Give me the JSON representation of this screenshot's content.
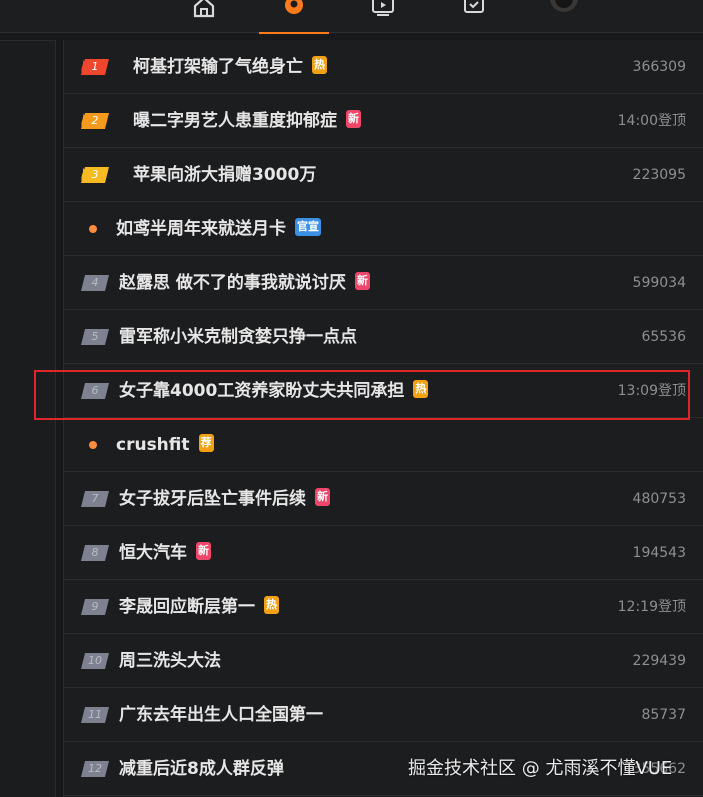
{
  "nav": {
    "tabs": [
      {
        "icon": "home-icon"
      },
      {
        "icon": "hot-flame-icon",
        "active": true
      },
      {
        "icon": "tv-icon"
      },
      {
        "icon": "calendar-check-icon"
      },
      {
        "icon": "avatar"
      }
    ]
  },
  "hot_list": [
    {
      "rank": "1",
      "title": "柯基打架输了气绝身亡",
      "badge": "热",
      "badge_type": "hot",
      "metric": "366309"
    },
    {
      "rank": "2",
      "title": "曝二字男艺人患重度抑郁症",
      "badge": "新",
      "badge_type": "new",
      "metric": "14:00登顶"
    },
    {
      "rank": "3",
      "title": "苹果向浙大捐赠3000万",
      "badge": "",
      "badge_type": "",
      "metric": "223095"
    },
    {
      "rank": "",
      "title": "如鸢半周年来就送月卡",
      "badge": "官宣",
      "badge_type": "official",
      "metric": ""
    },
    {
      "rank": "4",
      "title": "赵露思 做不了的事我就说讨厌",
      "badge": "新",
      "badge_type": "new",
      "metric": "599034"
    },
    {
      "rank": "5",
      "title": "雷军称小米克制贪婪只挣一点点",
      "badge": "",
      "badge_type": "",
      "metric": "65536"
    },
    {
      "rank": "6",
      "title": "女子靠4000工资养家盼丈夫共同承担",
      "badge": "热",
      "badge_type": "hot",
      "metric": "13:09登顶"
    },
    {
      "rank": "",
      "title": "crushfit",
      "badge": "荐",
      "badge_type": "rec",
      "metric": ""
    },
    {
      "rank": "7",
      "title": "女子拔牙后坠亡事件后续",
      "badge": "新",
      "badge_type": "new",
      "metric": "480753"
    },
    {
      "rank": "8",
      "title": "恒大汽车",
      "badge": "新",
      "badge_type": "new",
      "metric": "194543"
    },
    {
      "rank": "9",
      "title": "李晟回应断层第一",
      "badge": "热",
      "badge_type": "hot",
      "metric": "12:19登顶"
    },
    {
      "rank": "10",
      "title": "周三洗头大法",
      "badge": "",
      "badge_type": "",
      "metric": "229439"
    },
    {
      "rank": "11",
      "title": "广东去年出生人口全国第一",
      "badge": "",
      "badge_type": "",
      "metric": "85737"
    },
    {
      "rank": "12",
      "title": "减重后近8成人群反弹",
      "badge": "",
      "badge_type": "",
      "metric": "355662"
    }
  ],
  "colors": {
    "rank_1": "#f0462d",
    "rank_2": "#f59a1c",
    "rank_3": "#f6bb22",
    "rank_other": "#7d8190",
    "highlight_border": "#e0262b"
  },
  "watermark": "掘金技术社区 @ 尤雨溪不懂VUE"
}
